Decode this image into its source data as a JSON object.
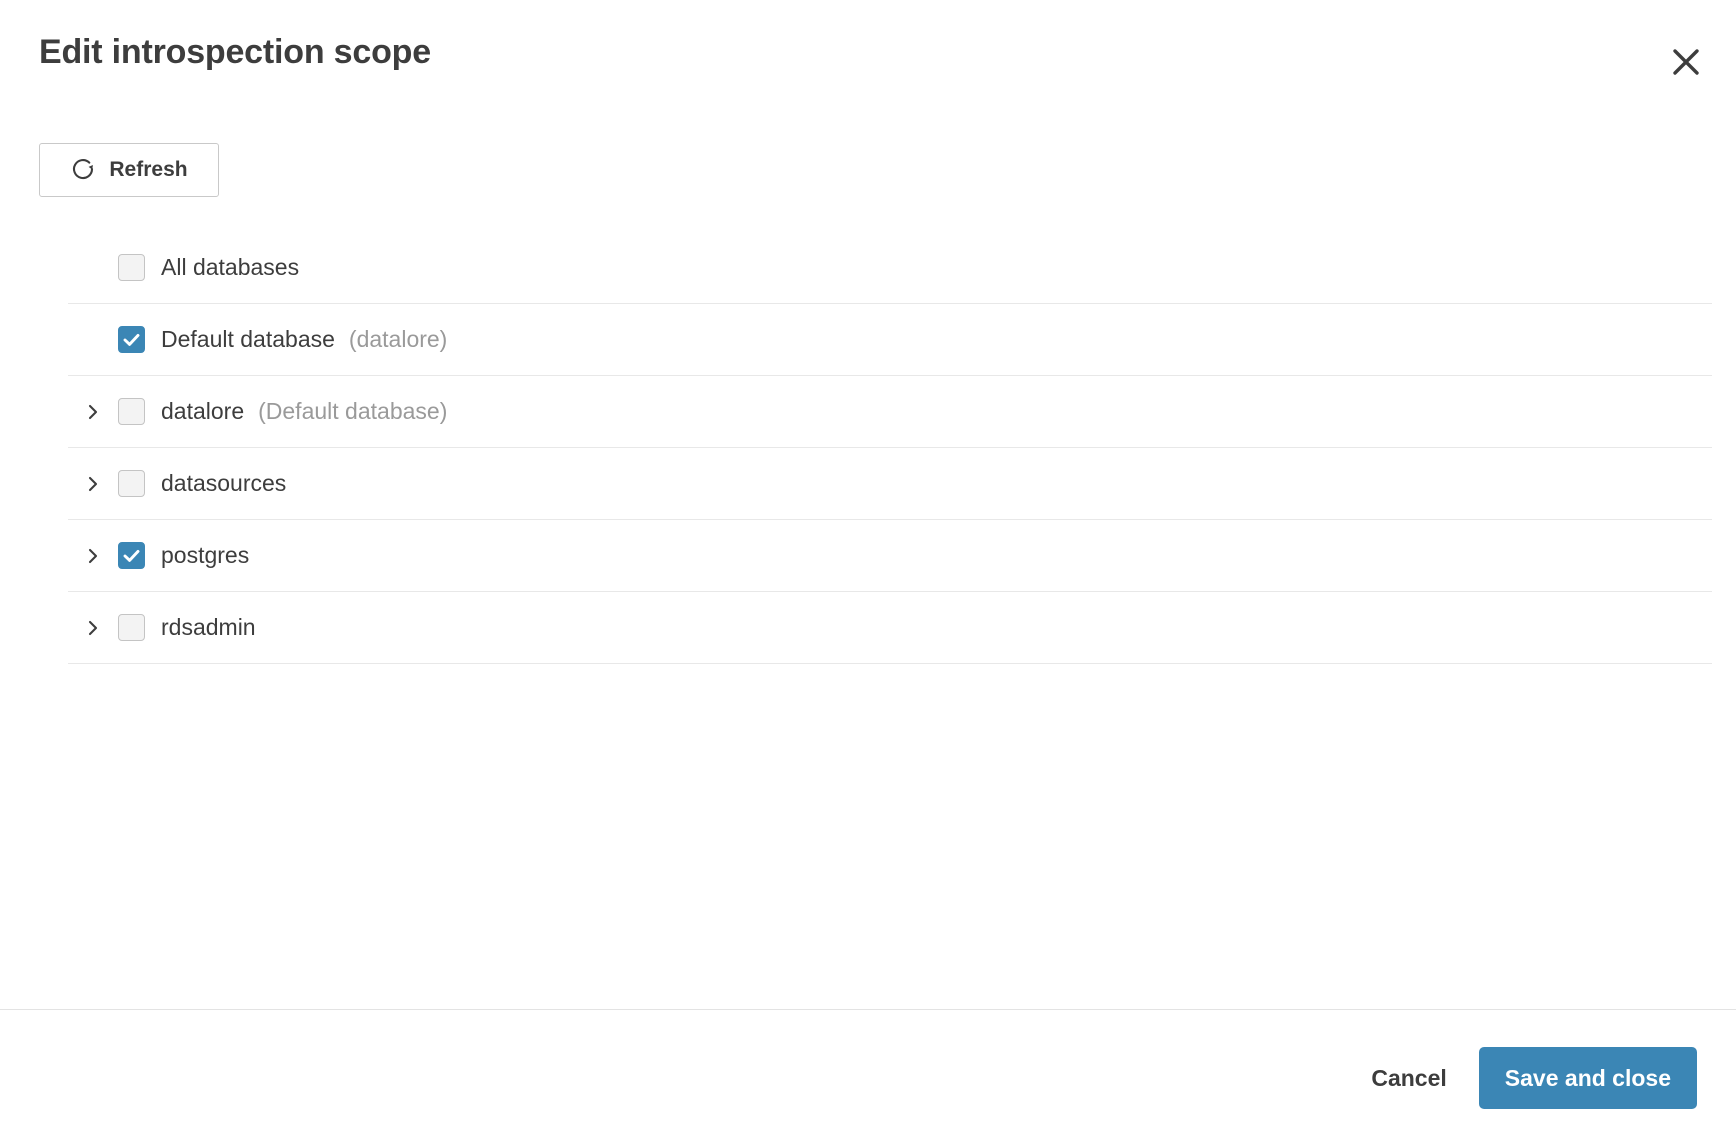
{
  "dialog": {
    "title": "Edit introspection scope",
    "close_icon": "close-icon"
  },
  "toolbar": {
    "refresh_label": "Refresh",
    "refresh_icon": "refresh-icon"
  },
  "list": {
    "rows": [
      {
        "label": "All databases",
        "note": "",
        "checked": false,
        "expandable": false,
        "expand_icon": ""
      },
      {
        "label": "Default database",
        "note": "(datalore)",
        "checked": true,
        "expandable": false,
        "expand_icon": ""
      },
      {
        "label": "datalore",
        "note": "(Default database)",
        "checked": false,
        "expandable": true,
        "expand_icon": "chevron-right-icon"
      },
      {
        "label": "datasources",
        "note": "",
        "checked": false,
        "expandable": true,
        "expand_icon": "chevron-right-icon"
      },
      {
        "label": "postgres",
        "note": "",
        "checked": true,
        "expandable": true,
        "expand_icon": "chevron-right-icon"
      },
      {
        "label": "rdsadmin",
        "note": "",
        "checked": false,
        "expandable": true,
        "expand_icon": "chevron-right-icon"
      }
    ]
  },
  "footer": {
    "cancel_label": "Cancel",
    "save_label": "Save and close"
  },
  "colors": {
    "accent": "#3b86b5",
    "text": "#3d3d3d",
    "muted": "#9a9a9a",
    "divider": "#e8e8e8",
    "checkbox_bg": "#f3f3f3",
    "checkbox_border": "#c4c4c4"
  }
}
